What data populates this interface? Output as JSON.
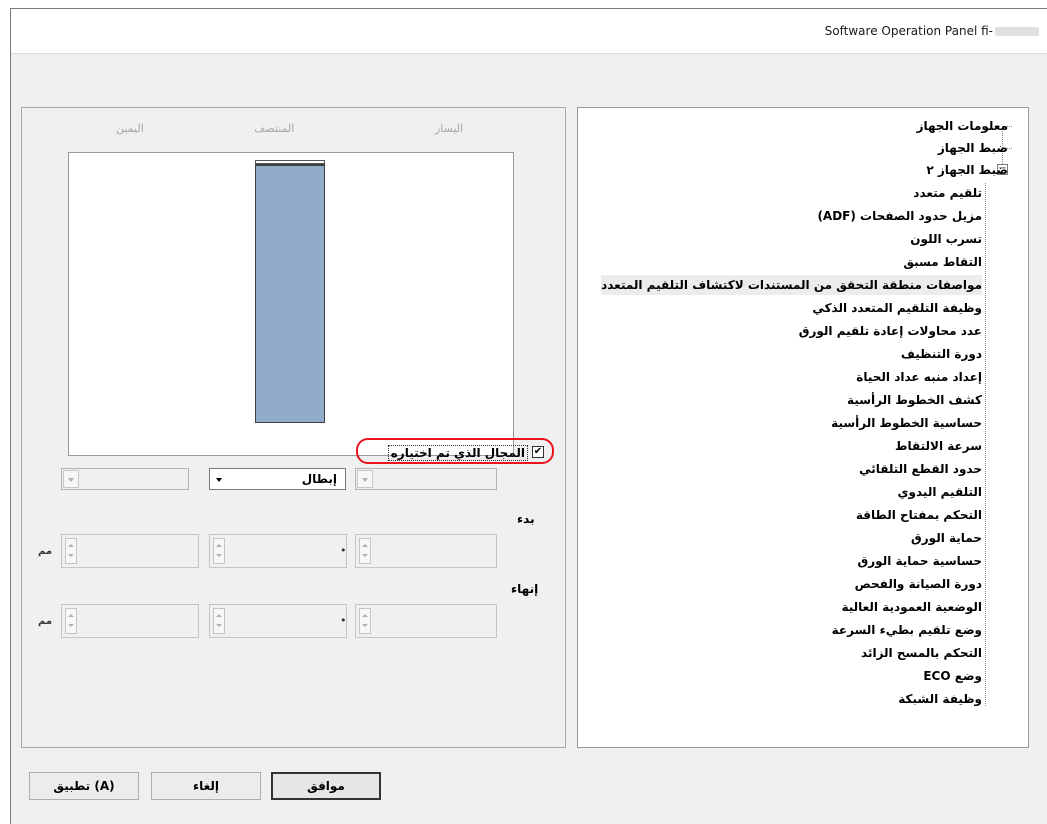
{
  "window": {
    "title": "Software Operation Panel fi-"
  },
  "left_panel": {
    "column_labels": {
      "right": "اليسار",
      "center": "المنتصف",
      "left": "اليمين"
    },
    "checkbox": {
      "label": "المجال الذي تم اختياره",
      "checked": true
    },
    "dropdowns": {
      "right": "",
      "center": "إبطال",
      "left": ""
    },
    "start_label": "بدء",
    "end_label": "إنهاء",
    "unit": "مم"
  },
  "tree": {
    "items": [
      {
        "label": "معلومات الجهاز",
        "level": 0
      },
      {
        "label": "ضبط الجهاز",
        "level": 0
      },
      {
        "label": "ضبط الجهاز ٢",
        "level": 0,
        "expanded": true
      },
      {
        "label": "تلقيم متعدد",
        "level": 1
      },
      {
        "label": "مزيل حدود الصفحات (ADF)",
        "level": 1
      },
      {
        "label": "تسرب اللون",
        "level": 1
      },
      {
        "label": "التقاط مسبق",
        "level": 1
      },
      {
        "label": "مواصفات منطقة التحقق من المستندات لاكتشاف التلقيم المتعدد",
        "level": 1,
        "selected": true
      },
      {
        "label": "وظيفة التلقيم المتعدد الذكي",
        "level": 1
      },
      {
        "label": "عدد محاولات إعادة تلقيم الورق",
        "level": 1
      },
      {
        "label": "دورة التنظيف",
        "level": 1
      },
      {
        "label": "إعداد منبه عداد الحياة",
        "level": 1
      },
      {
        "label": "كشف الخطوط الرأسية",
        "level": 1
      },
      {
        "label": "حساسية الخطوط الرأسية",
        "level": 1
      },
      {
        "label": "سرعة الالتقاط",
        "level": 1
      },
      {
        "label": "حدود القطع التلقائي",
        "level": 1
      },
      {
        "label": "التلقيم اليدوي",
        "level": 1
      },
      {
        "label": "التحكم بمفتاح الطاقة",
        "level": 1
      },
      {
        "label": "حماية الورق",
        "level": 1
      },
      {
        "label": "حساسية حماية الورق",
        "level": 1
      },
      {
        "label": "دورة الصيانة والفحص",
        "level": 1
      },
      {
        "label": "الوضعية العمودية العالية",
        "level": 1
      },
      {
        "label": "وضع تلقيم بطيء السرعة",
        "level": 1
      },
      {
        "label": "التحكم بالمسح الزائد",
        "level": 1
      },
      {
        "label": "وضع ECO",
        "level": 1
      },
      {
        "label": "وظيفة الشبكة",
        "level": 1
      }
    ]
  },
  "buttons": {
    "ok": "موافق",
    "cancel": "إلغاء",
    "apply": "تطبيق (A)"
  }
}
